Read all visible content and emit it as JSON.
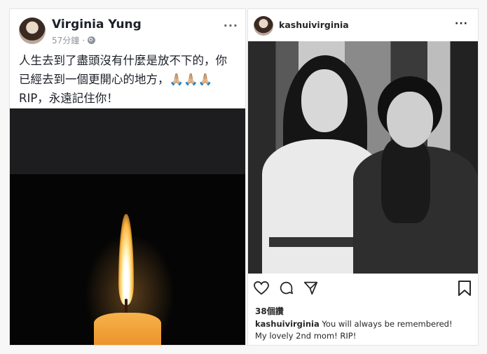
{
  "facebook_post": {
    "author_name": "Virginia Yung",
    "timestamp": "57分鐘",
    "separator": "·",
    "more_label": "···",
    "text_line1": "人生去到了盡頭沒有什麼是放不下的，你",
    "text_line2": "已經去到一個更開心的地方，🙏🏼🙏🏼🙏🏼",
    "text_line3": "RIP，永遠記住你！",
    "icons": [
      "avatar",
      "globe-icon",
      "more-icon"
    ]
  },
  "instagram_post": {
    "username": "kashuivirginia",
    "more_label": "···",
    "likes": "38個讚",
    "caption_username": "kashuivirginia",
    "caption_text": "You will always be remembered! My lovely 2nd mom! RIP!",
    "icons": [
      "heart-icon",
      "comment-icon",
      "share-icon",
      "bookmark-icon"
    ]
  }
}
